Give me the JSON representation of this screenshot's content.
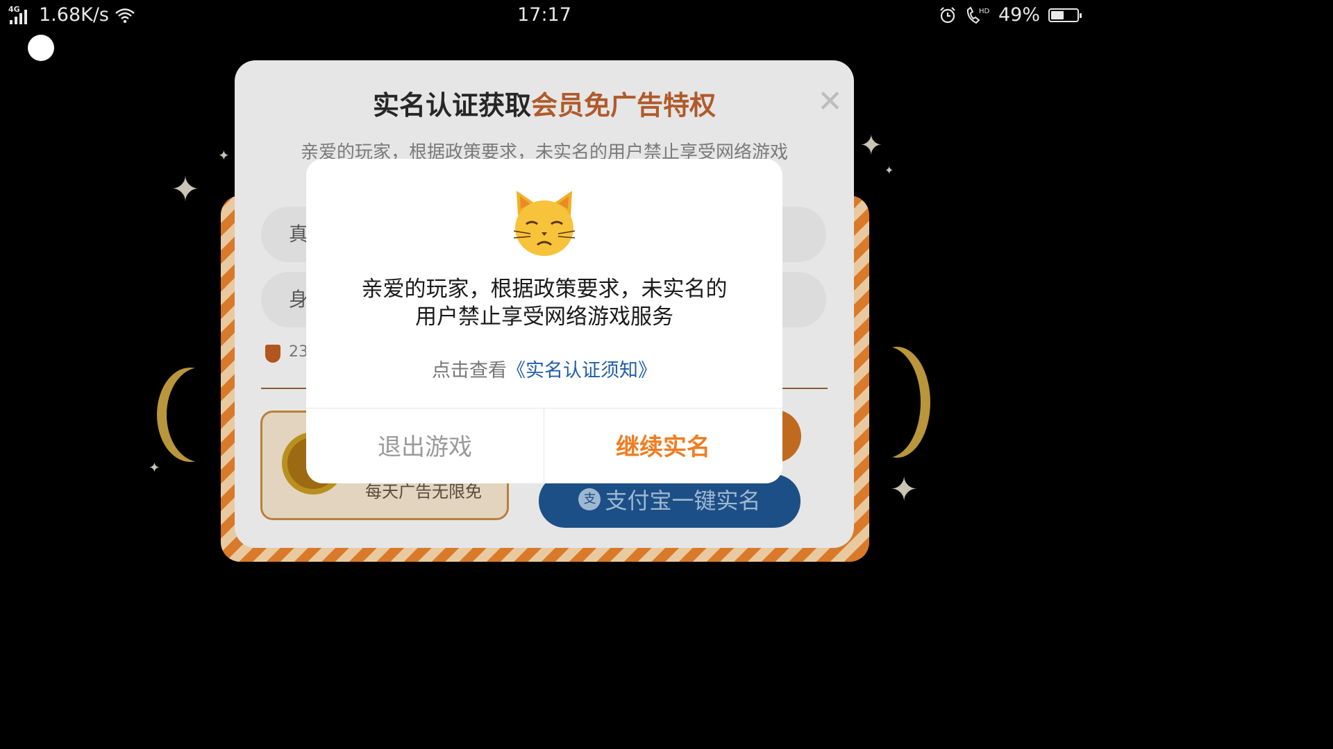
{
  "status_bar": {
    "network_type": "4G",
    "speed": "1.68K/s",
    "time": "17:17",
    "battery": "49%",
    "battery_level": 0.49,
    "icons": [
      "signal-icon",
      "wifi-icon",
      "alarm-icon",
      "hd-call-icon",
      "battery-icon"
    ]
  },
  "background_panel": {
    "title_prefix": "实名认证获取",
    "title_highlight": "会员免广告特权",
    "description": "亲爱的玩家，根据政策要求，未实名的用户禁止享受网络游戏",
    "name_field_label": "真",
    "id_field_label": "身",
    "notice_prefix": "23",
    "vip_card_text": "每天广告无限免",
    "alipay_icon_text": "支",
    "alipay_button": "支付宝一键实名",
    "colors": {
      "highlight": "#b05a2a",
      "alipay": "#1c4f86"
    }
  },
  "modal": {
    "icon": "cat-face-icon",
    "message_line1": "亲爱的玩家，根据政策要求，未实名的",
    "message_line2": "用户禁止享受网络游戏服务",
    "link_prefix": "点击查看",
    "link_text": "《实名认证须知》",
    "exit_button": "退出游戏",
    "continue_button": "继续实名",
    "colors": {
      "continue": "#f07c22",
      "link": "#1f5ea8",
      "exit": "#9a9a9a"
    }
  }
}
